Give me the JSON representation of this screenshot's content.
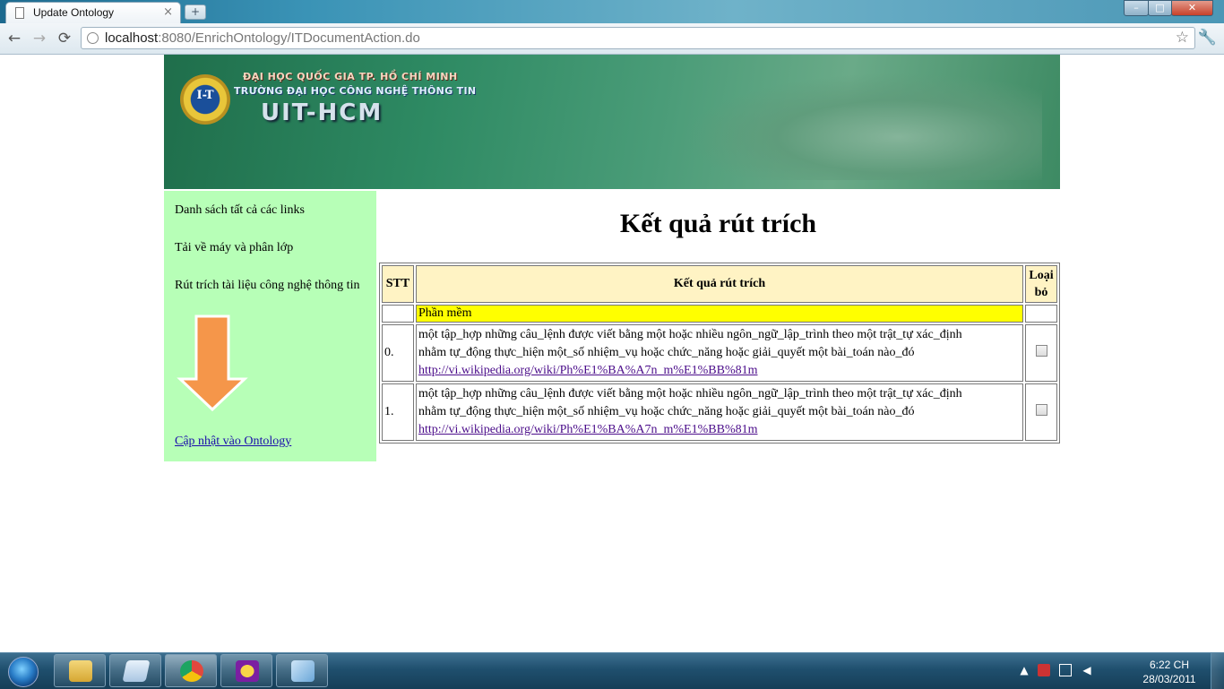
{
  "browser": {
    "tab_title": "Update Ontology",
    "tab_close": "×",
    "new_tab": "+",
    "url_host": "localhost",
    "url_rest": ":8080/EnrichOntology/ITDocumentAction.do",
    "nav": {
      "back": "←",
      "forward": "→",
      "reload": "⟳"
    },
    "star": "☆",
    "wrench": "🔧",
    "window": {
      "minimize": "–",
      "maximize": "□",
      "close": "✕"
    }
  },
  "banner": {
    "line1": "ĐẠI HỌC QUỐC GIA TP. HỒ CHÍ MINH",
    "line2": "TRƯỜNG ĐẠI HỌC CÔNG NGHỆ THÔNG TIN",
    "line3": "UIT-HCM",
    "logo_text": "I-T"
  },
  "sidebar": {
    "items": [
      {
        "label": "Danh sách tất cả các links"
      },
      {
        "label": "Tải về máy và phân lớp"
      },
      {
        "label": "Rút trích tài liệu công nghệ thông tin"
      }
    ],
    "arrow_icon": "down-arrow-icon",
    "update_link": "Cập nhật vào Ontology"
  },
  "main": {
    "heading": "Kết quả rút trích",
    "table": {
      "headers": {
        "stt": "STT",
        "result": "Kết quả rút trích",
        "remove_line1": "Loại",
        "remove_line2": "bỏ"
      },
      "category": "Phần mềm",
      "rows": [
        {
          "index": "0.",
          "text_line1": "một tập_hợp những câu_lệnh được viết bằng một hoặc nhiều ngôn_ngữ_lập_trình theo một trật_tự xác_định",
          "text_line2": "nhằm tự_động thực_hiện một_số nhiệm_vụ hoặc chức_năng hoặc giải_quyết một bài_toán nào_đó",
          "link": "http://vi.wikipedia.org/wiki/Ph%E1%BA%A7n_m%E1%BB%81m",
          "checked": false
        },
        {
          "index": "1.",
          "text_line1": "một tập_hợp những câu_lệnh được viết bằng một hoặc nhiều ngôn_ngữ_lập_trình theo một trật_tự xác_định",
          "text_line2": "nhằm tự_động thực_hiện một_số nhiệm_vụ hoặc chức_năng hoặc giải_quyết một bài_toán nào_đó",
          "link": "http://vi.wikipedia.org/wiki/Ph%E1%BA%A7n_m%E1%BB%81m",
          "checked": false
        }
      ]
    }
  },
  "taskbar": {
    "time": "6:22 CH",
    "date": "28/03/2011",
    "tray_arrow": "▲",
    "colors": {
      "explorer": "#e8c35a",
      "notepad": "#bcd4e8",
      "chrome": "#e2483d",
      "yahoo": "#7b1fa2",
      "virtualbox": "#6aa6d8"
    }
  }
}
